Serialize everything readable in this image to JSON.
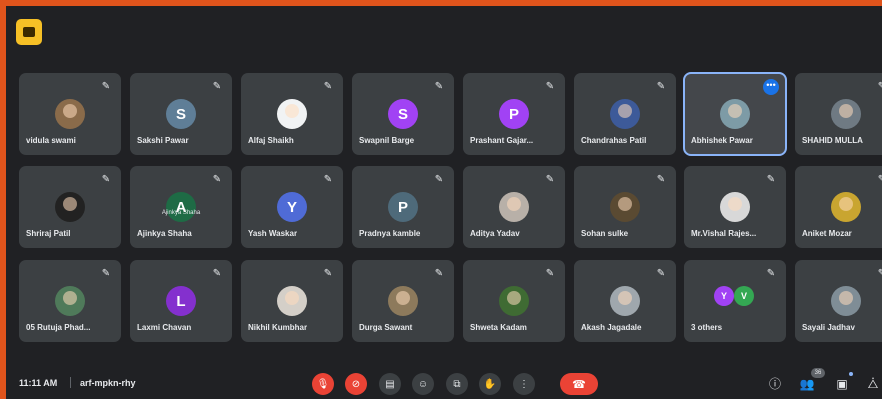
{
  "meeting": {
    "time": "11:11 AM",
    "separator": "|",
    "code": "arf-mpkn-rhy",
    "participant_count": "36"
  },
  "colors": {
    "frame": "#e0541c",
    "background": "#202124",
    "tile": "#3c4043",
    "active_outline": "#8ab4f8",
    "end_call": "#ea4335",
    "app_badge": "#f6c026"
  },
  "participants": [
    {
      "name": "vidula swami",
      "avatar_type": "photo",
      "color": "#8a6b4a"
    },
    {
      "name": "Sakshi Pawar",
      "avatar_type": "letter",
      "letter": "S",
      "color": "#5f7e97"
    },
    {
      "name": "Alfaj Shaikh",
      "avatar_type": "photo",
      "color": "#f1f3f4"
    },
    {
      "name": "Swapnil Barge",
      "avatar_type": "letter",
      "letter": "S",
      "color": "#a142f4"
    },
    {
      "name": "Prashant Gajar...",
      "avatar_type": "letter",
      "letter": "P",
      "color": "#a142f4"
    },
    {
      "name": "Chandrahas Patil",
      "avatar_type": "photo",
      "color": "#3d5a99"
    },
    {
      "name": "Abhishek Pawar",
      "avatar_type": "photo",
      "color": "#7d9ba6",
      "active": true,
      "more_icon": "more-horizontal-icon",
      "more_label": "•••"
    },
    {
      "name": "SHAHID MULLA",
      "avatar_type": "photo",
      "color": "#6f7a83"
    },
    {
      "name": "Shriraj Patil",
      "avatar_type": "photo",
      "color": "#222222"
    },
    {
      "name": "Ajinkya Shaha",
      "avatar_type": "letter",
      "letter": "A",
      "color": "#1e6b45",
      "caption": "Ajinkya Shaha"
    },
    {
      "name": "Yash Waskar",
      "avatar_type": "letter",
      "letter": "Y",
      "color": "#4f6bd6"
    },
    {
      "name": "Pradnya kamble",
      "avatar_type": "letter",
      "letter": "P",
      "color": "#4e6a7a"
    },
    {
      "name": "Aditya Yadav",
      "avatar_type": "photo",
      "color": "#b8b0a8"
    },
    {
      "name": "Sohan sulke",
      "avatar_type": "photo",
      "color": "#5a4a32"
    },
    {
      "name": "Mr.Vishal Rajes...",
      "avatar_type": "photo",
      "color": "#d8d8d8"
    },
    {
      "name": "Aniket Mozar",
      "avatar_type": "photo",
      "color": "#c9a530"
    },
    {
      "name": "05 Rutuja Phad...",
      "avatar_type": "photo",
      "color": "#4f7a5a"
    },
    {
      "name": "Laxmi Chavan",
      "avatar_type": "letter",
      "letter": "L",
      "color": "#8430ce"
    },
    {
      "name": "Nikhil Kumbhar",
      "avatar_type": "photo",
      "color": "#d4cfc8"
    },
    {
      "name": "Durga Sawant",
      "avatar_type": "photo",
      "color": "#8d7a5c"
    },
    {
      "name": "Shweta Kadam",
      "avatar_type": "photo",
      "color": "#3f6b33"
    },
    {
      "name": "Akash Jagadale",
      "avatar_type": "photo",
      "color": "#9fa7ad"
    },
    {
      "name": "3 others",
      "avatar_type": "others",
      "letters": [
        "Y",
        "V"
      ],
      "colors": [
        "#a142f4",
        "#34a853"
      ]
    },
    {
      "name": "Sayali Jadhav",
      "avatar_type": "photo",
      "color": "#7f8d96"
    }
  ],
  "mic_icon": "mic-off-icon",
  "mic_glyph": "✎",
  "controls": [
    {
      "name": "mic-toggle-button",
      "icon": "mic-off-icon",
      "glyph": "🎙",
      "red": true
    },
    {
      "name": "camera-toggle-button",
      "icon": "camera-off-icon",
      "glyph": "⊘",
      "red": true
    },
    {
      "name": "captions-button",
      "icon": "captions-icon",
      "glyph": "▤",
      "red": false
    },
    {
      "name": "emoji-button",
      "icon": "emoji-icon",
      "glyph": "☺",
      "red": false
    },
    {
      "name": "present-button",
      "icon": "present-screen-icon",
      "glyph": "⧉",
      "red": false
    },
    {
      "name": "raise-hand-button",
      "icon": "raise-hand-icon",
      "glyph": "✋",
      "red": false
    },
    {
      "name": "more-options-button",
      "icon": "more-vertical-icon",
      "glyph": "⋮",
      "red": false
    }
  ],
  "end_call": {
    "icon": "end-call-icon",
    "glyph": "☎"
  },
  "right_controls": [
    {
      "name": "meeting-details-button",
      "icon": "info-icon",
      "glyph": "ⓘ"
    },
    {
      "name": "people-button",
      "icon": "people-icon",
      "glyph": "👥"
    },
    {
      "name": "chat-button",
      "icon": "chat-icon",
      "glyph": "▣"
    },
    {
      "name": "activities-button",
      "icon": "activities-icon",
      "glyph": "⧊"
    }
  ]
}
